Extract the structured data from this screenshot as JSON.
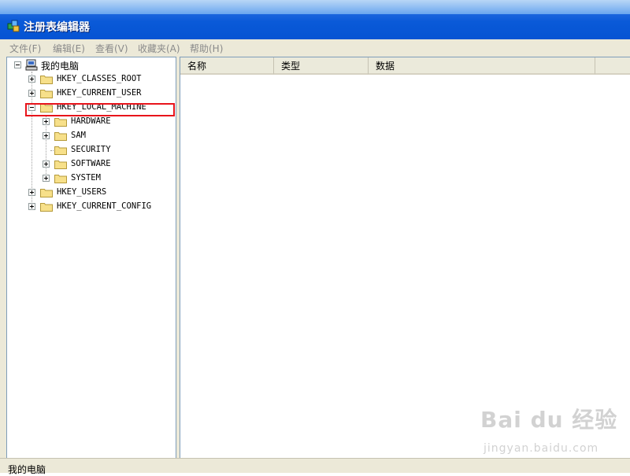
{
  "window": {
    "title": "注册表编辑器",
    "icon": "registry-editor-icon"
  },
  "menu": [
    {
      "label": "文件(F)"
    },
    {
      "label": "编辑(E)"
    },
    {
      "label": "查看(V)"
    },
    {
      "label": "收藏夹(A)"
    },
    {
      "label": "帮助(H)"
    }
  ],
  "tree": {
    "root": {
      "label": "我的电脑",
      "icon": "computer-icon"
    },
    "hives": [
      {
        "label": "HKEY_CLASSES_ROOT",
        "expanded": false
      },
      {
        "label": "HKEY_CURRENT_USER",
        "expanded": false
      },
      {
        "label": "HKEY_LOCAL_MACHINE",
        "expanded": true,
        "highlighted": true
      },
      {
        "label": "HKEY_USERS",
        "expanded": false
      },
      {
        "label": "HKEY_CURRENT_CONFIG",
        "expanded": false
      }
    ],
    "local_machine_children": [
      {
        "label": "HARDWARE",
        "has_children": true
      },
      {
        "label": "SAM",
        "has_children": true
      },
      {
        "label": "SECURITY",
        "has_children": false
      },
      {
        "label": "SOFTWARE",
        "has_children": true
      },
      {
        "label": "SYSTEM",
        "has_children": true
      }
    ]
  },
  "list": {
    "columns": [
      {
        "label": "名称"
      },
      {
        "label": "类型"
      },
      {
        "label": "数据"
      }
    ]
  },
  "statusbar": {
    "text": "我的电脑"
  },
  "watermark": {
    "brand": "Bai du 经验",
    "url": "jingyan.baidu.com"
  },
  "colors": {
    "highlight": "#e8141b",
    "titlebar": "#0a5ad8",
    "menu_disabled": "#8a8a8a"
  }
}
